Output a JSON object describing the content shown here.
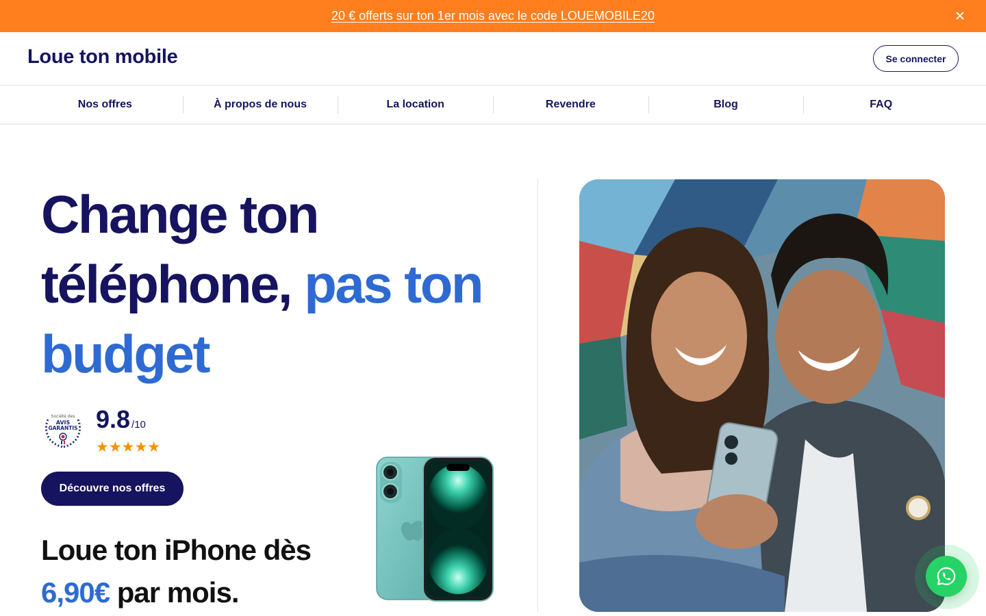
{
  "promo": {
    "text": "20 € offerts sur ton 1er mois avec le code LOUEMOBILE20",
    "close_icon": "close-icon"
  },
  "header": {
    "logo": "Loue ton mobile",
    "login_label": "Se connecter"
  },
  "nav": {
    "items": [
      {
        "label": "Nos offres"
      },
      {
        "label": "À propos de nous"
      },
      {
        "label": "La location"
      },
      {
        "label": "Revendre"
      },
      {
        "label": "Blog"
      },
      {
        "label": "FAQ"
      }
    ]
  },
  "hero": {
    "headline_part1": "Change ton téléphone, ",
    "headline_part2": "pas ton budget",
    "rating": {
      "badge_line1": "Société des",
      "badge_line2": "AVIS",
      "badge_line3": "GARANTIS",
      "score": "9.8",
      "out_of": "/10",
      "stars": "★★★★★"
    },
    "cta_label": "Découvre nos offres",
    "pricing_line1": "Loue ton iPhone dès",
    "pricing_price": "6,90€",
    "pricing_suffix": " par mois."
  },
  "floating": {
    "whatsapp_icon": "whatsapp-icon"
  },
  "colors": {
    "brand_navy": "#16135f",
    "accent_blue": "#2e6ad1",
    "promo_orange": "#ff7f1f",
    "star_orange": "#f29200",
    "whatsapp_green": "#25d366"
  }
}
